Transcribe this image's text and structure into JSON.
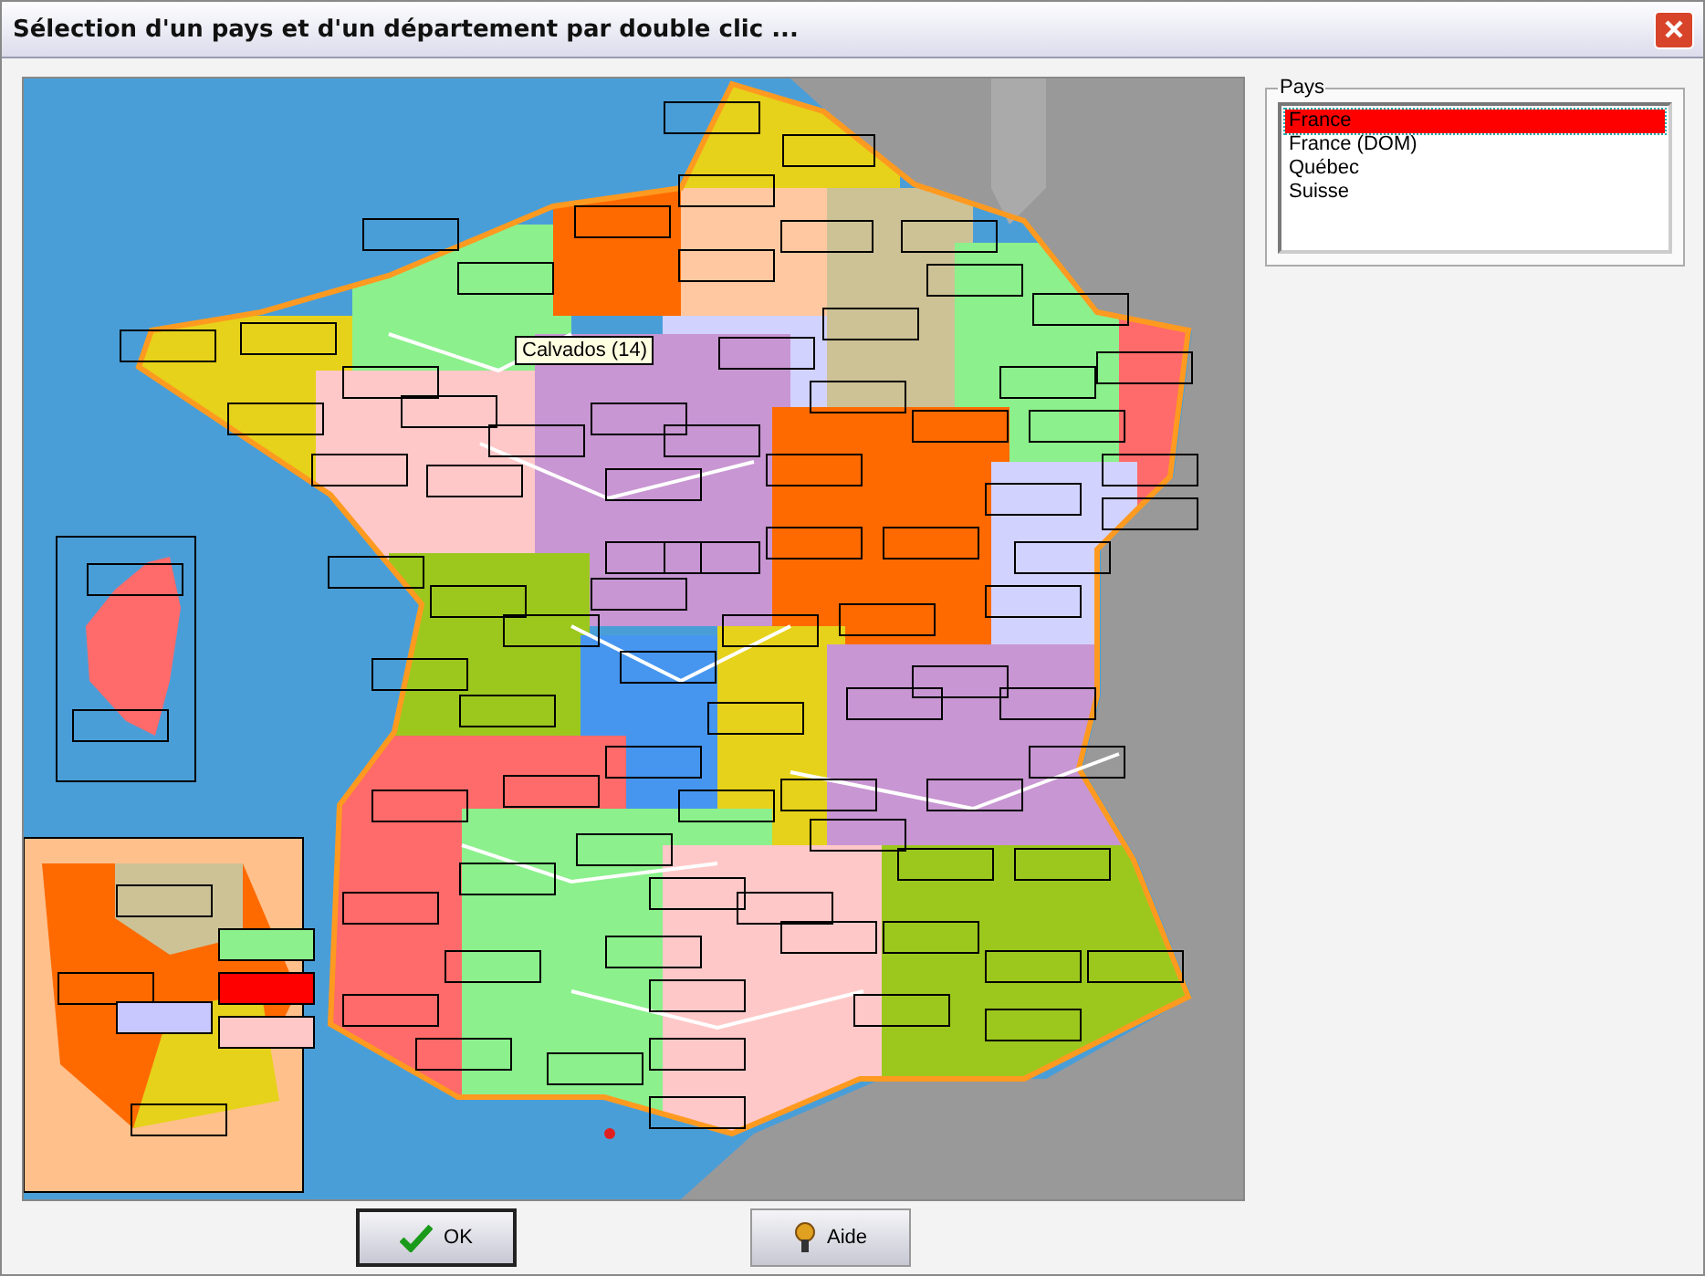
{
  "window": {
    "title": "Sélection d'un pays et d'un département par double clic ..."
  },
  "map": {
    "tooltip": "Calvados (14)"
  },
  "countries": {
    "label": "Pays",
    "items": [
      {
        "label": "France",
        "selected": true
      },
      {
        "label": "France (DOM)",
        "selected": false
      },
      {
        "label": "Québec",
        "selected": false
      },
      {
        "label": "Suisse",
        "selected": false
      }
    ]
  },
  "buttons": [
    {
      "kind": "ok",
      "label": "OK"
    },
    {
      "kind": "help",
      "label": "Aide"
    }
  ]
}
